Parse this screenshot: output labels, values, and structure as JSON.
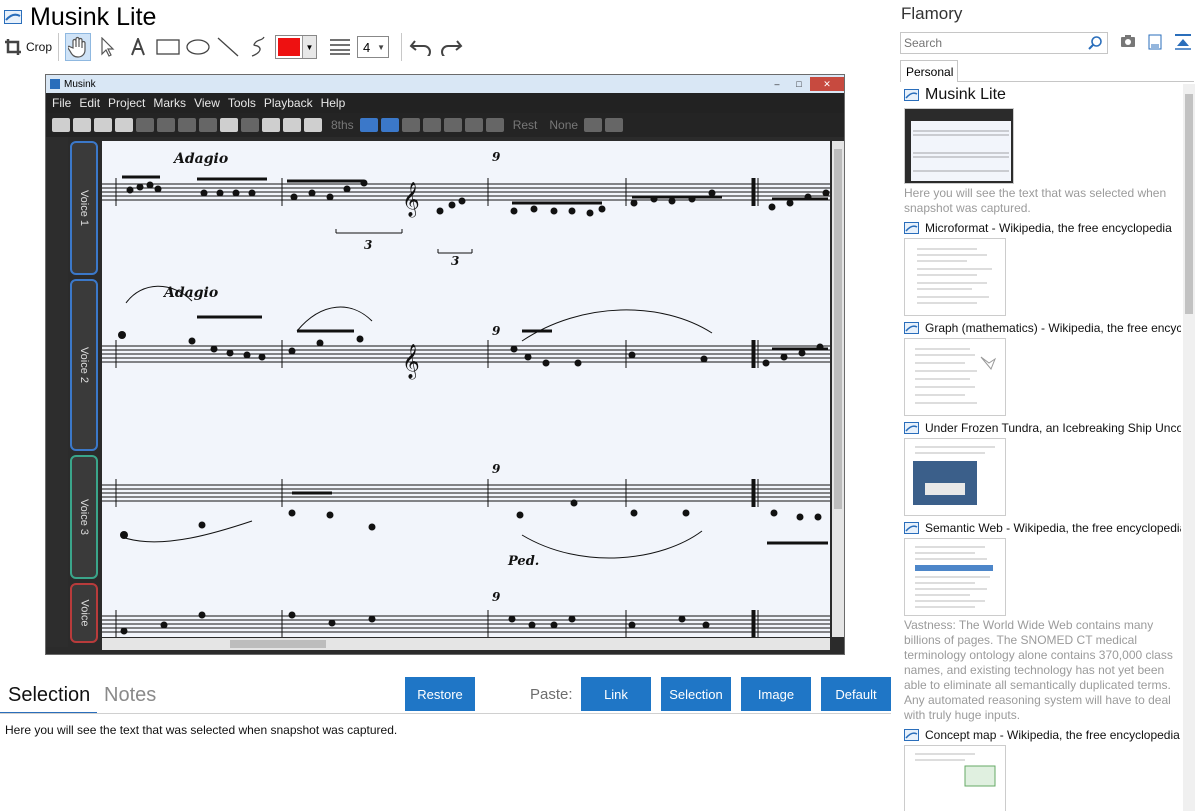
{
  "app": {
    "title": "Musink Lite"
  },
  "toolbar": {
    "crop_label": "Crop",
    "line_width": "4",
    "current_color": "#ee1111",
    "tools": [
      "hand-icon",
      "pointer-icon",
      "text-icon",
      "rectangle-icon",
      "ellipse-icon",
      "line-icon",
      "freehand-icon",
      "undo-icon",
      "redo-icon"
    ]
  },
  "snapshot": {
    "window_title": "Musink",
    "menu": [
      "File",
      "Edit",
      "Project",
      "Marks",
      "View",
      "Tools",
      "Playback",
      "Help"
    ],
    "toolbar_texts": {
      "duration": "8ths",
      "rest": "Rest",
      "none": "None"
    },
    "voices": [
      "Voice 1",
      "Voice 2",
      "Voice 3",
      "Voice"
    ],
    "tempo_marks": [
      "Adagio",
      "Adagio"
    ],
    "measure_numbers": [
      "9",
      "9",
      "9",
      "9"
    ],
    "tuplets": [
      "3",
      "3"
    ],
    "pedal_mark": "Ped."
  },
  "tabs": {
    "selection": "Selection",
    "notes": "Notes"
  },
  "buttons": {
    "restore": "Restore",
    "paste_label": "Paste:",
    "link": "Link",
    "selection": "Selection",
    "image": "Image",
    "default": "Default"
  },
  "selection_text": "Here you will see the text that was selected when snapshot was captured.",
  "sidebar": {
    "title": "Flamory",
    "search_placeholder": "Search",
    "tab": "Personal",
    "items": [
      {
        "title": "Musink Lite",
        "desc": "Here you will see the text that was selected when snapshot was captured."
      },
      {
        "title": "Microformat - Wikipedia, the free encyclopedia",
        "desc": ""
      },
      {
        "title": "Graph (mathematics) - Wikipedia, the free encyclopedia",
        "desc": ""
      },
      {
        "title": "Under Frozen Tundra, an Icebreaking Ship Uncovers",
        "desc": ""
      },
      {
        "title": "Semantic Web - Wikipedia, the free encyclopedia",
        "desc": "Vastness: The World Wide Web contains many billions of pages. The SNOMED CT medical terminology ontology alone contains 370,000 class names, and existing technology has not yet been able to eliminate all semantically duplicated terms. Any automated reasoning system will have to deal with truly huge inputs."
      },
      {
        "title": "Concept map - Wikipedia, the free encyclopedia",
        "desc": ""
      }
    ]
  },
  "colors": {
    "accent": "#1f76c6",
    "text_muted": "#9b9b9b"
  }
}
